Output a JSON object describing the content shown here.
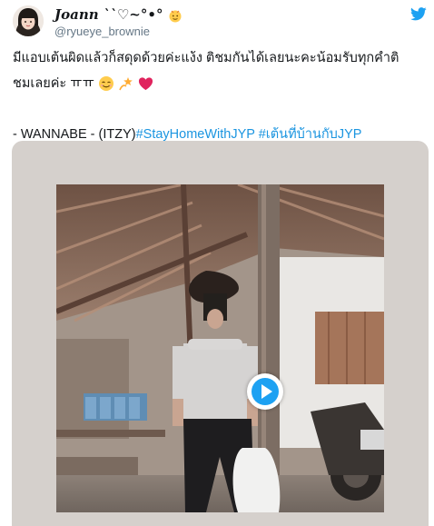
{
  "tweet": {
    "display_name": "Joann ``♡~°•°",
    "handle": "@ryueye_brownie",
    "text_line1": "มีแอบเต้นผิดแล้วก็สดุดด้วยค่ะแง้ง ติชมกันได้เลยนะคะน้อมรับทุกคำติ",
    "text_line2_text": "ชมเลยค่ะ ㅠㅠ",
    "text_line3_prefix": "- WANNABE - (ITZY)",
    "hashtag1": "#StayHomeWithJYP",
    "hashtag2": "#เต้นที่บ้านกับJYP"
  },
  "icons": {
    "brand": "twitter-bird-icon",
    "media_play": "play-icon",
    "name_emoji": "face-emoji-icon",
    "line2_emojis": [
      "smiling-face-emoji-icon",
      "dizzy-emoji-icon",
      "heart-emoji-icon"
    ]
  },
  "colors": {
    "link": "#1b95e0",
    "brand": "#1da1f2",
    "text": "#14171a",
    "handle": "#657786",
    "media_frame": "#d5d0cc",
    "heart": "#e0245e"
  }
}
